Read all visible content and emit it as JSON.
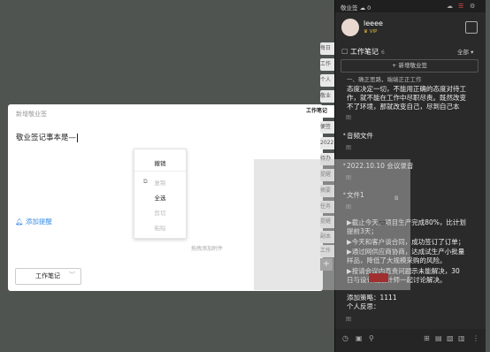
{
  "editor": {
    "title": "新增敬业签",
    "content": "敬业签记事本是—",
    "reminder": "添加提醒",
    "attach_hint": "拖拽添加附件",
    "category": "工作笔记",
    "category_chevron": "chevron-down-icon"
  },
  "context_menu": {
    "undo": "撤销",
    "copy": "复制",
    "select_all": "全选",
    "cut": "剪切",
    "paste": "粘贴"
  },
  "tabs": [
    "每日",
    "工作",
    "个人",
    "敬业",
    "工作笔记",
    "便签",
    "2022",
    "待办",
    "提醒",
    "摘要",
    "任务",
    "提醒",
    "副本",
    "工作"
  ],
  "active_tab": "工作笔记",
  "panel": {
    "app_name": "敬业签",
    "cloud_count": "0",
    "username": "leeee",
    "vip": "VIP",
    "section_title": "工作笔记",
    "section_count": "6",
    "sort": "全部",
    "add_button": "+ 新增敬业签",
    "note1_line0": "一、确正思路，端端正正工作",
    "note1_line1": "态度决定一切，不能用正确的态度对待工",
    "note1_line2": "作，就不能在工作中尽职尽责。既然改变",
    "note1_line3": "不了环境，那就改变自己，尽到自己本",
    "note2": "音频文件",
    "note3": "2022.10.10 会议录音",
    "note4": "文件1",
    "note4_extra": "B",
    "note5_l1": "▶截止今天，项目生产完成80%，比计划",
    "note5_l2": "提前3天；",
    "note5_l3": "▶今天和客户谈合同，成功签订了订单；",
    "note5_l4": "▶通过网供应商协商，达成试生产小批量",
    "note5_l5": "样品，降低了大规模采购的风险。",
    "note5_l6": "▶按请会议内直责问题示未能解决，30",
    "note5_l7": "日与设计院设计师一起讨论解决。",
    "note5_l8": "添加策略：1111",
    "note5_l9": "个人反思：",
    "image_label": "图"
  },
  "colors": {
    "accent": "#3a8ee6",
    "vip": "#e5b93e",
    "panel_bg": "#2a2a2a"
  }
}
